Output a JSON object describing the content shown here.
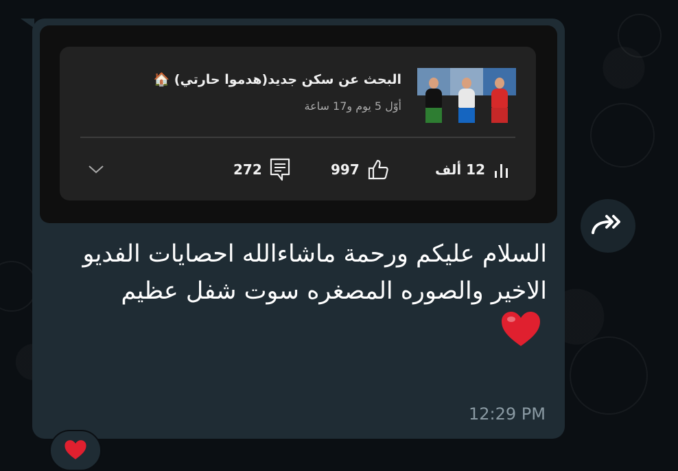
{
  "video_card": {
    "title": "البحث عن سكن جديد(هدموا حارتي) 🏠",
    "subtitle": "أوّل 5 يوم و17 ساعة",
    "views": "12 ألف",
    "likes": "997",
    "comments": "272",
    "thumbnail_colors": [
      "#1b6b2f",
      "#c0c0c0",
      "#d62a2a"
    ]
  },
  "message": {
    "text": "السلام عليكم ورحمة ماشاءالله احصايات الفديو الاخير والصوره المصغره سوت شفل عظيم",
    "emoji": "heart-emoji",
    "time": "12:29 PM"
  },
  "forward": {
    "icon": "double-forward-icon"
  },
  "reaction": {
    "icon": "heart-emoji"
  },
  "colors": {
    "background": "#0b0f13",
    "bubble": "#1f2c34",
    "card": "#222222",
    "heart": "#e0202f"
  }
}
